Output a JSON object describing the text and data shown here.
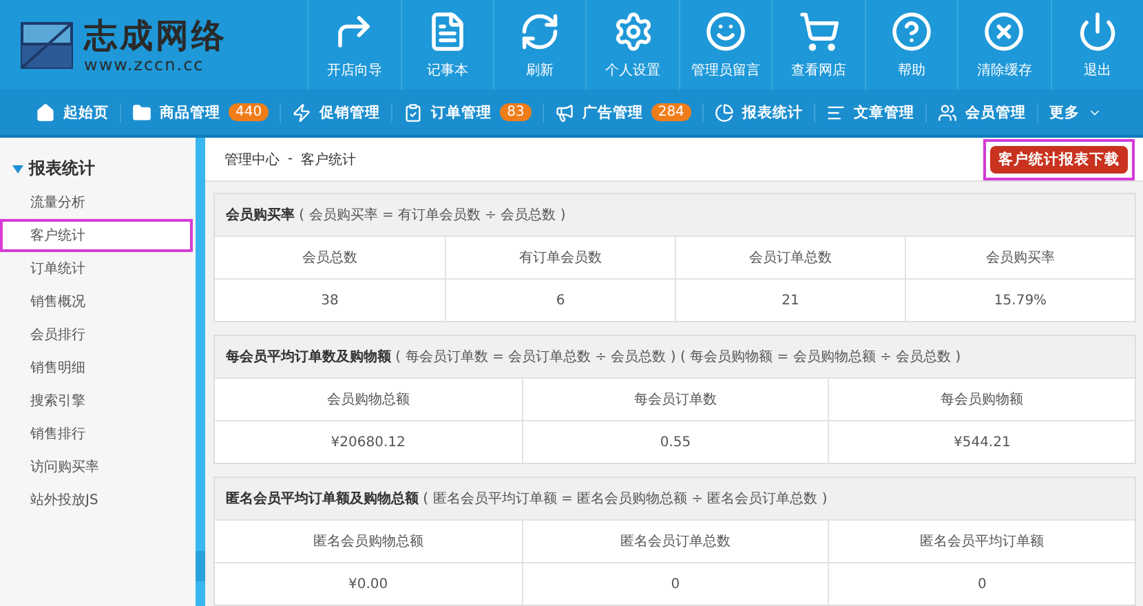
{
  "logo": {
    "name": "志成网络",
    "url": "www.zccn.cc"
  },
  "toolbar": [
    {
      "label": "开店向导"
    },
    {
      "label": "记事本"
    },
    {
      "label": "刷新"
    },
    {
      "label": "个人设置"
    },
    {
      "label": "管理员留言"
    },
    {
      "label": "查看网店"
    },
    {
      "label": "帮助"
    },
    {
      "label": "清除缓存"
    },
    {
      "label": "退出"
    }
  ],
  "nav": [
    {
      "label": "起始页"
    },
    {
      "label": "商品管理",
      "badge": "440"
    },
    {
      "label": "促销管理"
    },
    {
      "label": "订单管理",
      "badge": "83"
    },
    {
      "label": "广告管理",
      "badge": "284"
    },
    {
      "label": "报表统计"
    },
    {
      "label": "文章管理"
    },
    {
      "label": "会员管理"
    },
    {
      "label": "更多",
      "dropdown": true
    }
  ],
  "sidebar": {
    "title": "报表统计",
    "expanded": true,
    "items": [
      {
        "label": "流量分析",
        "selected": false
      },
      {
        "label": "客户统计",
        "selected": true
      },
      {
        "label": "订单统计",
        "selected": false
      },
      {
        "label": "销售概况",
        "selected": false
      },
      {
        "label": "会员排行",
        "selected": false
      },
      {
        "label": "销售明细",
        "selected": false
      },
      {
        "label": "搜索引擎",
        "selected": false
      },
      {
        "label": "销售排行",
        "selected": false
      },
      {
        "label": "访问购买率",
        "selected": false
      },
      {
        "label": "站外投放JS",
        "selected": false
      }
    ]
  },
  "breadcrumb": [
    "管理中心",
    "-",
    "客户统计"
  ],
  "download_button": {
    "label": "客户统计报表下载",
    "highlighted": true
  },
  "panels": [
    {
      "title": "**会员购买率** ( 会员购买率 = 有订单会员数 ÷ 会员总数 )",
      "columns": [
        "会员总数",
        "有订单会员数",
        "会员订单总数",
        "会员购买率"
      ],
      "values": [
        "38",
        "6",
        "21",
        "15.79%"
      ]
    },
    {
      "title": "**每会员平均订单数及购物额** ( 每会员订单数 = 会员订单总数 ÷ 会员总数 ) ( 每会员购物额 = 会员购物总额 ÷ 会员总数 )",
      "columns": [
        "会员购物总额",
        "每会员订单数",
        "每会员购物额"
      ],
      "values": [
        "¥20680.12",
        "0.55",
        "¥544.21"
      ]
    },
    {
      "title": "**匿名会员平均订单额及购物总额** ( 匿名会员平均订单额 = 匿名会员购物总额 ÷ 匿名会员订单总数 )",
      "columns": [
        "匿名会员购物总额",
        "匿名会员订单总数",
        "匿名会员平均订单额"
      ],
      "values": [
        "¥0.00",
        "0",
        "0"
      ]
    }
  ]
}
